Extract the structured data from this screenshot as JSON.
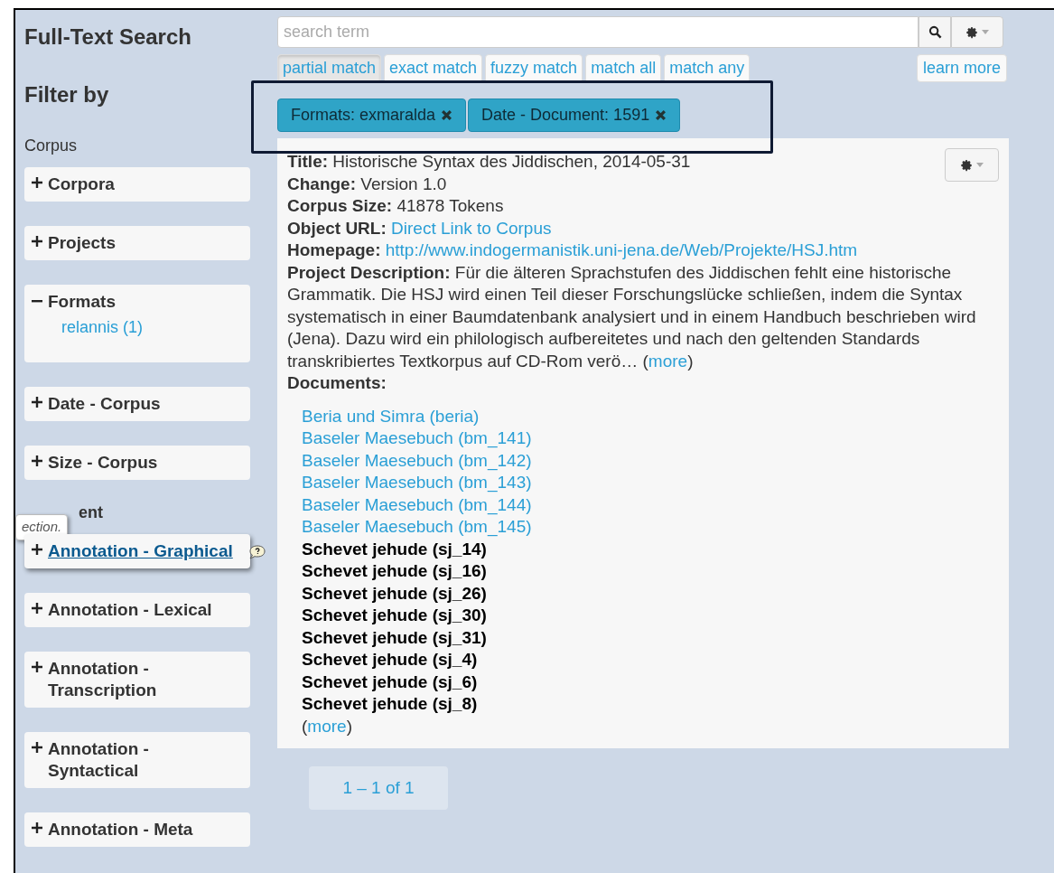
{
  "sidebar": {
    "title": "Full-Text Search",
    "filter_heading": "Filter by",
    "sections": [
      {
        "heading": "Corpus",
        "items": [
          {
            "label": "Corpora",
            "expanded": false,
            "hovered": false
          },
          {
            "label": "Projects",
            "expanded": false,
            "hovered": false
          },
          {
            "label": "Formats",
            "expanded": true,
            "hovered": false,
            "children": [
              "relannis (1)"
            ]
          },
          {
            "label": "Date - Corpus",
            "expanded": false,
            "hovered": false
          },
          {
            "label": "Size - Corpus",
            "expanded": false,
            "hovered": false
          }
        ]
      },
      {
        "heading": "ent",
        "tooltip": "ection.",
        "items": [
          {
            "label": "Annotation - Graphical",
            "expanded": false,
            "hovered": true
          },
          {
            "label": "Annotation - Lexical",
            "expanded": false,
            "hovered": false
          },
          {
            "label": "Annotation - Transcription",
            "expanded": false,
            "hovered": false
          },
          {
            "label": "Annotation - Syntactical",
            "expanded": false,
            "hovered": false
          },
          {
            "label": "Annotation - Meta",
            "expanded": false,
            "hovered": false
          }
        ]
      }
    ]
  },
  "search": {
    "placeholder": "search term"
  },
  "match_modes": [
    {
      "label": "partial match",
      "selected": true
    },
    {
      "label": "exact match",
      "selected": false
    },
    {
      "label": "fuzzy match",
      "selected": false
    },
    {
      "label": "match all",
      "selected": false
    },
    {
      "label": "match any",
      "selected": false
    }
  ],
  "learn_more": "learn more",
  "active_filters": [
    "Formats: exmaralda",
    "Date - Document: 1591"
  ],
  "result": {
    "fields": [
      {
        "label": "Title:",
        "value": "Historische Syntax des Jiddischen, 2014-05-31",
        "kind": "text"
      },
      {
        "label": "Change:",
        "value": "Version 1.0",
        "kind": "text"
      },
      {
        "label": "Corpus Size:",
        "value": "41878 Tokens",
        "kind": "text"
      },
      {
        "label": "Object URL:",
        "value": "Direct Link to Corpus",
        "kind": "link"
      },
      {
        "label": "Homepage:",
        "value": "http://www.indogermanistik.uni-jena.de/Web/Projekte/HSJ.htm",
        "kind": "link"
      }
    ],
    "description_label": "Project Description:",
    "description": "Für die älteren Sprachstufen des Jiddischen fehlt eine historische Grammatik. Die HSJ wird einen Teil dieser Forschungslücke schließen, indem die Syntax systematisch in einer Baumdatenbank analysiert und in einem Handbuch beschrieben wird (Jena). Dazu wird ein philologisch aufbereitetes und nach den geltenden Standards transkribiertes Textkorpus auf CD-Rom verö…",
    "description_more": {
      "open": "(",
      "link": "more",
      "close": ")"
    },
    "documents_label": "Documents:",
    "documents": [
      {
        "label": "Beria und Simra (beria)",
        "kind": "link"
      },
      {
        "label": "Baseler Maesebuch (bm_141)",
        "kind": "link"
      },
      {
        "label": "Baseler Maesebuch (bm_142)",
        "kind": "link"
      },
      {
        "label": "Baseler Maesebuch (bm_143)",
        "kind": "link"
      },
      {
        "label": "Baseler Maesebuch (bm_144)",
        "kind": "link"
      },
      {
        "label": "Baseler Maesebuch (bm_145)",
        "kind": "link"
      },
      {
        "label": "Schevet jehude (sj_14)",
        "kind": "bold"
      },
      {
        "label": "Schevet jehude (sj_16)",
        "kind": "bold"
      },
      {
        "label": "Schevet jehude (sj_26)",
        "kind": "bold"
      },
      {
        "label": "Schevet jehude (sj_30)",
        "kind": "bold"
      },
      {
        "label": "Schevet jehude (sj_31)",
        "kind": "bold"
      },
      {
        "label": "Schevet jehude (sj_4)",
        "kind": "bold"
      },
      {
        "label": "Schevet jehude (sj_6)",
        "kind": "bold"
      },
      {
        "label": "Schevet jehude (sj_8)",
        "kind": "bold"
      }
    ],
    "documents_more": {
      "open": "(",
      "link": "more",
      "close": ")"
    }
  },
  "pagination": "1 – 1 of 1"
}
